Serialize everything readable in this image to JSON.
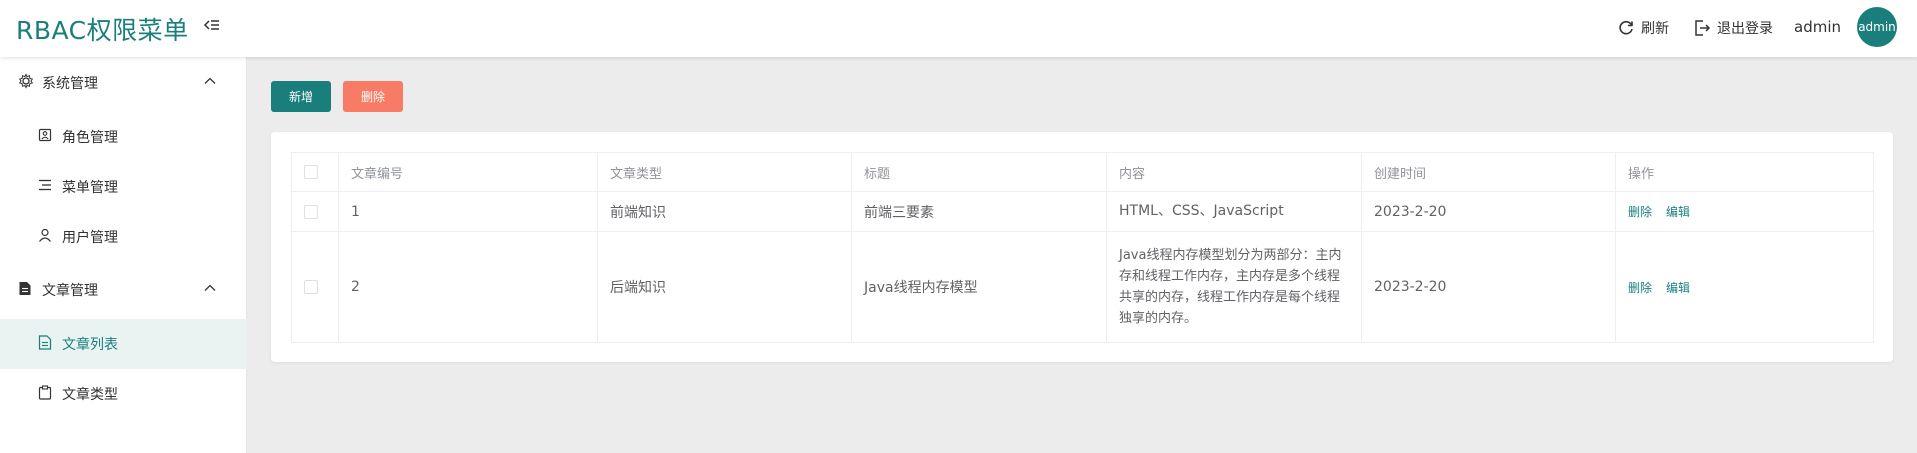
{
  "header": {
    "logo": "RBAC权限菜单",
    "refresh_label": "刷新",
    "logout_label": "退出登录",
    "username": "admin",
    "avatar_text": "admin",
    "accent_color": "#1a7f7c"
  },
  "sidebar": {
    "groups": [
      {
        "label": "系统管理",
        "icon": "settings-icon",
        "expanded": true,
        "items": [
          {
            "label": "角色管理",
            "icon": "role-icon"
          },
          {
            "label": "菜单管理",
            "icon": "menu-list-icon"
          },
          {
            "label": "用户管理",
            "icon": "user-icon"
          }
        ]
      },
      {
        "label": "文章管理",
        "icon": "document-icon",
        "expanded": true,
        "items": [
          {
            "label": "文章列表",
            "icon": "article-icon",
            "active": true
          },
          {
            "label": "文章类型",
            "icon": "clipboard-icon"
          }
        ]
      }
    ]
  },
  "toolbar": {
    "add_label": "新增",
    "delete_label": "删除",
    "delete_color": "#f77b65"
  },
  "table": {
    "columns": [
      "文章编号",
      "文章类型",
      "标题",
      "内容",
      "创建时间",
      "操作"
    ],
    "rows": [
      {
        "id": "1",
        "type": "前端知识",
        "title": "前端三要素",
        "content": "HTML、CSS、JavaScript",
        "created": "2023-2-20",
        "delete_label": "删除",
        "edit_label": "编辑"
      },
      {
        "id": "2",
        "type": "后端知识",
        "title": "Java线程内存模型",
        "content": "Java线程内存模型划分为两部分：主内存和线程工作内存，主内存是多个线程共享的内存，线程工作内存是每个线程独享的内存。",
        "created": "2023-2-20",
        "delete_label": "删除",
        "edit_label": "编辑"
      }
    ]
  }
}
